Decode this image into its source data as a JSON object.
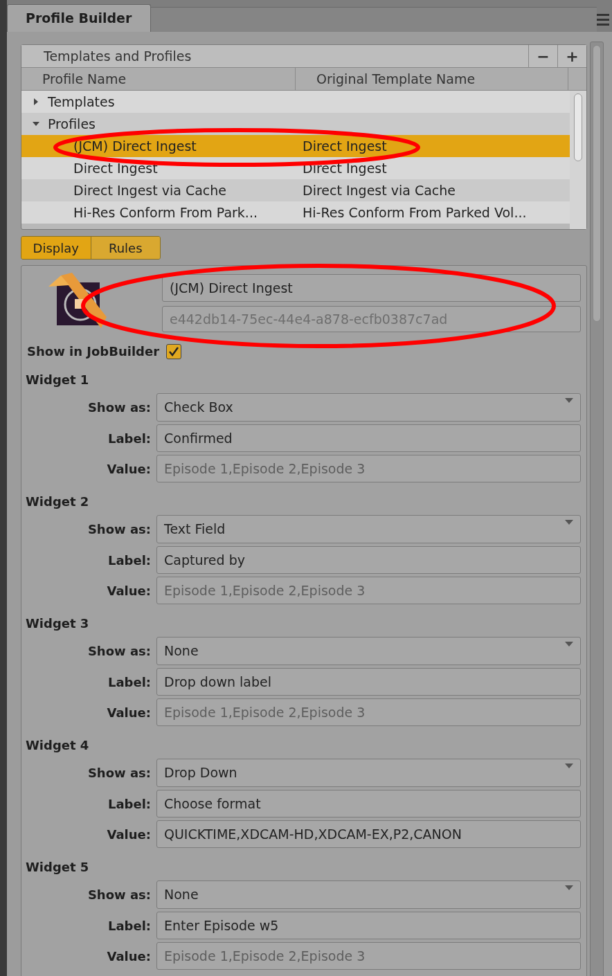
{
  "panel_tab": {
    "label": "Profile Builder",
    "selected": true
  },
  "templates_panel": {
    "title": "Templates and Profiles",
    "remove_button": "−",
    "add_button": "+",
    "columns": [
      "Profile Name",
      "Original Template Name"
    ],
    "tree": [
      {
        "label": "Templates",
        "expanded": false
      },
      {
        "label": "Profiles",
        "expanded": true,
        "children": [
          {
            "name": "(JCM) Direct Ingest",
            "template": "Direct Ingest",
            "selected": true
          },
          {
            "name": "Direct Ingest",
            "template": "Direct Ingest",
            "selected": false
          },
          {
            "name": "Direct Ingest via Cache",
            "template": "Direct Ingest via Cache",
            "selected": false
          },
          {
            "name": "Hi-Res Conform From Park...",
            "template": "Hi-Res Conform From Parked Vol...",
            "selected": false
          }
        ]
      }
    ]
  },
  "view_tabs": [
    {
      "label": "Display",
      "selected": true
    },
    {
      "label": "Rules",
      "selected": false
    }
  ],
  "profile": {
    "name": "(JCM) Direct Ingest",
    "id": "e442db14-75ec-44e4-a878-ecfb0387c7ad",
    "show_in_jobbuilder": {
      "label": "Show in JobBuilder",
      "checked": true
    }
  },
  "widgets": [
    {
      "title": "Widget 1",
      "fields": [
        {
          "kind": "dropdown",
          "label": "Show as:",
          "value": "Check Box"
        },
        {
          "kind": "text",
          "label": "Label:",
          "value": "Confirmed"
        },
        {
          "kind": "text",
          "label": "Value:",
          "placeholder": "Episode 1,Episode 2,Episode 3"
        }
      ]
    },
    {
      "title": "Widget 2",
      "fields": [
        {
          "kind": "dropdown",
          "label": "Show as:",
          "value": "Text Field"
        },
        {
          "kind": "text",
          "label": "Label:",
          "value": "Captured by"
        },
        {
          "kind": "text",
          "label": "Value:",
          "placeholder": "Episode 1,Episode 2,Episode 3"
        }
      ]
    },
    {
      "title": "Widget 3",
      "fields": [
        {
          "kind": "dropdown",
          "label": "Show as:",
          "value": "None"
        },
        {
          "kind": "text",
          "label": "Label:",
          "value": "Drop down label"
        },
        {
          "kind": "text",
          "label": "Value:",
          "placeholder": "Episode 1,Episode 2,Episode 3"
        }
      ]
    },
    {
      "title": "Widget 4",
      "fields": [
        {
          "kind": "dropdown",
          "label": "Show as:",
          "value": "Drop Down"
        },
        {
          "kind": "text",
          "label": "Label:",
          "value": "Choose format"
        },
        {
          "kind": "text",
          "label": "Value:",
          "value": "QUICKTIME,XDCAM-HD,XDCAM-EX,P2,CANON"
        }
      ]
    },
    {
      "title": "Widget 5",
      "fields": [
        {
          "kind": "dropdown",
          "label": "Show as:",
          "value": "None"
        },
        {
          "kind": "text",
          "label": "Label:",
          "value": "Enter Episode w5"
        },
        {
          "kind": "text",
          "label": "Value:",
          "placeholder": "Episode 1,Episode 2,Episode 3"
        }
      ]
    }
  ]
}
